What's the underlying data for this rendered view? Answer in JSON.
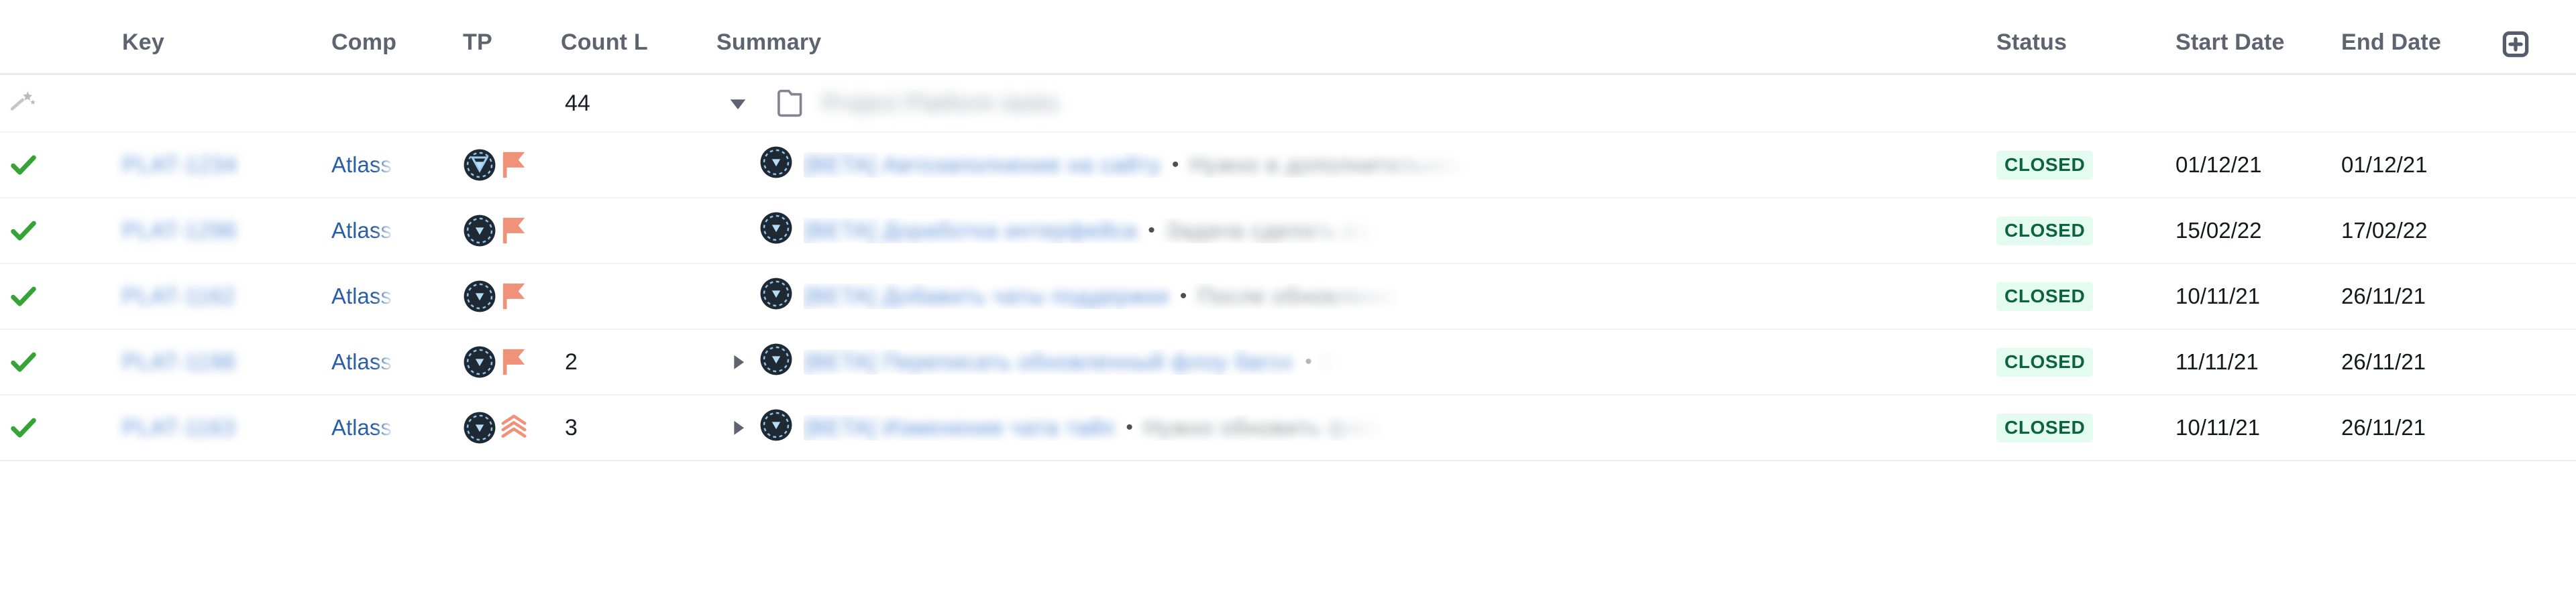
{
  "table": {
    "columns": [
      {
        "id": "flag",
        "label": "",
        "truncated": false
      },
      {
        "id": "key",
        "label": "Key",
        "truncated": false
      },
      {
        "id": "comp",
        "label": "Comp",
        "truncated": true
      },
      {
        "id": "tp",
        "label": "TP",
        "truncated": false
      },
      {
        "id": "count",
        "label": "Count L",
        "truncated": true
      },
      {
        "id": "summary",
        "label": "Summary",
        "truncated": false
      },
      {
        "id": "status",
        "label": "Status",
        "truncated": false
      },
      {
        "id": "start",
        "label": "Start Date",
        "truncated": true
      },
      {
        "id": "end",
        "label": "End Date",
        "truncated": false
      }
    ],
    "header_actions": [
      {
        "name": "add-column-button",
        "icon": "plus-box-icon"
      },
      {
        "name": "settings-button",
        "icon": "gear-icon"
      }
    ],
    "group_row": {
      "wand_icon": "magic-wand-icon",
      "count": "44",
      "expander": "triangle-down-icon",
      "folder_icon": "folder-icon",
      "title_redacted": "Project Platform tasks"
    },
    "rows": [
      {
        "status_icon": "green-check-icon",
        "key_redacted": "PLAT-1234",
        "component": "Atlass",
        "avatar_icon": "project-avatar-icon",
        "priority_icon": "priority-medium-flag-icon",
        "count": "",
        "expander": "",
        "summary_link_redacted": "[BETA] Автозаполнение на сайту",
        "summary_bullet": "•",
        "summary_desc_redacted": "Нужно в дополнительном",
        "status": "CLOSED",
        "start_date": "01/12/21",
        "end_date": "01/12/21"
      },
      {
        "status_icon": "green-check-icon",
        "key_redacted": "PLAT-1296",
        "component": "Atlass",
        "avatar_icon": "project-avatar-icon",
        "priority_icon": "priority-medium-flag-icon",
        "count": "",
        "expander": "",
        "summary_link_redacted": "[BETA] Доработка интерфейса",
        "summary_bullet": "•",
        "summary_desc_redacted": "Задача сделать jira",
        "status": "CLOSED",
        "start_date": "15/02/22",
        "end_date": "17/02/22"
      },
      {
        "status_icon": "green-check-icon",
        "key_redacted": "PLAT-1162",
        "component": "Atlass",
        "avatar_icon": "project-avatar-icon",
        "priority_icon": "priority-medium-flag-icon",
        "count": "",
        "expander": "",
        "summary_link_redacted": "[BETA] Добавить чаты поддержки",
        "summary_bullet": "•",
        "summary_desc_redacted": "После обновления",
        "status": "CLOSED",
        "start_date": "10/11/21",
        "end_date": "26/11/21"
      },
      {
        "status_icon": "green-check-icon",
        "key_redacted": "PLAT-1198",
        "component": "Atlass",
        "avatar_icon": "project-avatar-icon",
        "priority_icon": "priority-medium-flag-icon",
        "count": "2",
        "expander": "triangle-right-icon",
        "summary_link_redacted": "[BETA] Переписать обновленный флоу багов",
        "summary_bullet": "•",
        "summary_desc_redacted": "П",
        "status": "CLOSED",
        "start_date": "11/11/21",
        "end_date": "26/11/21"
      },
      {
        "status_icon": "green-check-icon",
        "key_redacted": "PLAT-1163",
        "component": "Atlass",
        "avatar_icon": "project-avatar-icon",
        "priority_icon": "priority-high-chevrons-icon",
        "count": "3",
        "expander": "triangle-right-icon",
        "summary_link_redacted": "[BETA] Изменение чата тайп",
        "summary_bullet": "•",
        "summary_desc_redacted": "Нужно обновить флоу",
        "status": "CLOSED",
        "start_date": "10/11/21",
        "end_date": "26/11/21"
      }
    ]
  },
  "colors": {
    "status_badge_bg": "#e4fcef",
    "status_badge_text": "#0c6342",
    "check_green": "#36a336",
    "link_blue": "#5b8ed6",
    "component_blue": "#2a5fa8",
    "header_gray": "#5d6470",
    "priority_orange": "#f2917a"
  }
}
